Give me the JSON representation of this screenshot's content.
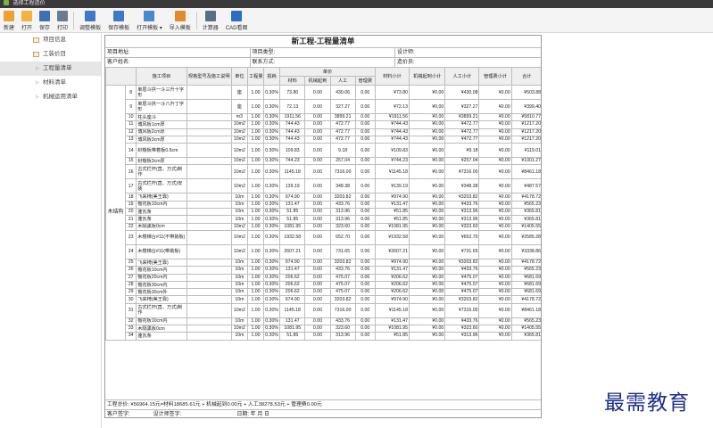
{
  "window": {
    "title": "选择工程造价"
  },
  "toolbar": {
    "items": [
      {
        "label": "新建",
        "icon": "new-file-icon",
        "color": "#f0a030"
      },
      {
        "label": "打开",
        "icon": "open-folder-icon",
        "color": "#f3b33d"
      },
      {
        "label": "保存",
        "icon": "save-icon",
        "color": "#3d6fb6"
      },
      {
        "label": "打印",
        "icon": "print-icon",
        "color": "#6b7b8c"
      },
      {
        "label": "调整模板",
        "icon": "template-adjust-icon",
        "color": "#3f78c8"
      },
      {
        "label": "保存模板",
        "icon": "template-save-icon",
        "color": "#3f78c8"
      },
      {
        "label": "打开模板 ▾",
        "icon": "template-open-icon",
        "color": "#4a88d0"
      },
      {
        "label": "导入模板",
        "icon": "template-import-icon",
        "color": "#e08a2c"
      },
      {
        "label": "计算器",
        "icon": "calculator-icon",
        "color": "#5a6e86"
      },
      {
        "label": "CAD看图",
        "icon": "cad-viewer-icon",
        "color": "#2c6cc4"
      }
    ]
  },
  "sidebar": {
    "items": [
      {
        "label": "项目信息",
        "type": "page"
      },
      {
        "label": "工装价目",
        "type": "page"
      },
      {
        "label": "工程量清单",
        "type": "node",
        "selected": true
      },
      {
        "label": "材料清单",
        "type": "node"
      },
      {
        "label": "机械运用清单",
        "type": "node"
      }
    ]
  },
  "document": {
    "title": "新工程-工程量清单",
    "info_row1": [
      "项目地址:",
      "项目类型:",
      "设计师:"
    ],
    "info_row2": [
      "客户姓名:",
      "联系方式:",
      "造价员:"
    ],
    "headers": {
      "unit_price_group": "单价",
      "cols": [
        "施工项目",
        "规格型号及施工说明",
        "单位",
        "工程量",
        "损耗",
        "材料",
        "机械起到",
        "人工",
        "管理费",
        "材料小计",
        "机械起到小计",
        "人工小计",
        "管理费小计",
        "合计"
      ]
    },
    "group_label": "木结构",
    "rows": [
      [
        "8",
        "单层斗拱一斗三升十字形",
        "座",
        "1.00",
        "0.30%",
        "73.80",
        "0.00",
        "430.06",
        "0.00",
        "¥73.80",
        "¥0.00",
        "¥430.08",
        "¥0.00",
        "¥503.88"
      ],
      [
        "9",
        "单层斗拱一斗八升丁字形",
        "座",
        "1.00",
        "0.30%",
        "72.13",
        "0.00",
        "327.27",
        "0.00",
        "¥72.13",
        "¥0.00",
        "¥327.27",
        "¥0.00",
        "¥399.40"
      ],
      [
        "10",
        "柱头座斗",
        "m3",
        "1.00",
        "0.30%",
        "1911.56",
        "0.00",
        "3899.21",
        "0.00",
        "¥1911.56",
        "¥0.00",
        "¥3899.21",
        "¥0.00",
        "¥5810.77"
      ],
      [
        "11",
        "博风板1cm厚",
        "10m2",
        "1.00",
        "0.30%",
        "744.43",
        "0.00",
        "472.77",
        "0.00",
        "¥744.43",
        "¥0.00",
        "¥472.77",
        "¥0.00",
        "¥1217.20"
      ],
      [
        "12",
        "博风板2cm厚",
        "10m2",
        "1.00",
        "0.30%",
        "744.43",
        "0.00",
        "472.77",
        "0.00",
        "¥744.43",
        "¥0.00",
        "¥472.77",
        "¥0.00",
        "¥1217.20"
      ],
      [
        "13",
        "博风板3cm厚",
        "10m2",
        "1.00",
        "0.30%",
        "744.43",
        "0.00",
        "472.77",
        "0.00",
        "¥744.43",
        "¥0.00",
        "¥472.77",
        "¥0.00",
        "¥1217.20"
      ],
      [
        "14",
        "封檐板带着板0.5cm",
        "10m2",
        "1.00",
        "0.30%",
        "109.83",
        "0.00",
        "9.18",
        "0.00",
        "¥109.83",
        "¥0.00",
        "¥9.18",
        "¥0.00",
        "¥119.01"
      ],
      [
        "15",
        "封檐板3cm厚",
        "10m2",
        "1.00",
        "0.30%",
        "744.23",
        "0.00",
        "257.04",
        "0.00",
        "¥744.23",
        "¥0.00",
        "¥257.04",
        "¥0.00",
        "¥1001.27"
      ],
      [
        "16",
        "古式栏杆(直、万式)制作",
        "10m2",
        "1.00",
        "0.30%",
        "1145.18",
        "0.00",
        "7316.00",
        "0.00",
        "¥1145.18",
        "¥0.00",
        "¥7316.00",
        "¥0.00",
        "¥8461.18"
      ],
      [
        "17",
        "古式栏杆(直、万式)安装",
        "10m2",
        "1.00",
        "0.30%",
        "139.19",
        "0.00",
        "348.38",
        "0.00",
        "¥139.19",
        "¥0.00",
        "¥348.38",
        "¥0.00",
        "¥487.57"
      ],
      [
        "18",
        "飞来椅(美王靠)",
        "10m",
        "1.00",
        "0.30%",
        "974.90",
        "0.00",
        "3203.82",
        "0.00",
        "¥974.90",
        "¥0.00",
        "¥3203.82",
        "¥0.00",
        "¥4178.72"
      ],
      [
        "19",
        "檐花板10cm内",
        "10m",
        "1.00",
        "0.30%",
        "131.47",
        "0.00",
        "433.76",
        "0.00",
        "¥131.47",
        "¥0.00",
        "¥433.76",
        "¥0.00",
        "¥565.23"
      ],
      [
        "20",
        "蓬瓦条",
        "10m",
        "1.00",
        "0.30%",
        "51.85",
        "0.00",
        "313.96",
        "0.00",
        "¥51.85",
        "¥0.00",
        "¥313.96",
        "¥0.00",
        "¥365.81"
      ],
      [
        "21",
        "蓬瓦条",
        "10m",
        "1.00",
        "0.30%",
        "51.85",
        "0.00",
        "313.96",
        "0.00",
        "¥51.85",
        "¥0.00",
        "¥313.96",
        "¥0.00",
        "¥365.81"
      ],
      [
        "22",
        "木隔黑板0cm",
        "10m2",
        "1.00",
        "0.30%",
        "1081.95",
        "0.00",
        "323.60",
        "0.00",
        "¥1081.95",
        "¥0.00",
        "¥323.60",
        "¥0.00",
        "¥1405.55"
      ],
      [
        "23",
        "木楼梯台#11(不带挑板)",
        "10m2",
        "1.00",
        "0.30%",
        "1932.58",
        "0.00",
        "652.70",
        "0.00",
        "¥1932.58",
        "¥0.00",
        "¥652.70",
        "¥0.00",
        "¥2585.28"
      ],
      [
        "24",
        "木楼梯台#11(带挑板)",
        "10m2",
        "1.00",
        "0.30%",
        "2607.21",
        "0.00",
        "731.65",
        "0.00",
        "¥2607.21",
        "¥0.00",
        "¥731.65",
        "¥0.00",
        "¥3338.86"
      ],
      [
        "25",
        "飞来椅(美王靠)",
        "10m",
        "1.00",
        "0.30%",
        "974.90",
        "0.00",
        "3203.82",
        "0.00",
        "¥974.90",
        "¥0.00",
        "¥3203.82",
        "¥0.00",
        "¥4178.72"
      ],
      [
        "26",
        "檐花板10cm内",
        "10m",
        "1.00",
        "0.30%",
        "131.47",
        "0.00",
        "433.76",
        "0.00",
        "¥131.47",
        "¥0.00",
        "¥433.76",
        "¥0.00",
        "¥565.23"
      ],
      [
        "27",
        "檐花板20cm内",
        "10m",
        "1.00",
        "0.30%",
        "206.62",
        "0.00",
        "475.07",
        "0.00",
        "¥206.62",
        "¥0.00",
        "¥475.07",
        "¥0.00",
        "¥681.69"
      ],
      [
        "28",
        "檐花板30cm内",
        "10m",
        "1.00",
        "0.30%",
        "206.62",
        "0.00",
        "475.07",
        "0.00",
        "¥206.62",
        "¥0.00",
        "¥475.07",
        "¥0.00",
        "¥681.69"
      ],
      [
        "29",
        "檐花板30cm外",
        "10m",
        "1.00",
        "0.30%",
        "206.62",
        "0.00",
        "475.07",
        "0.00",
        "¥206.62",
        "¥0.00",
        "¥475.07",
        "¥0.00",
        "¥681.69"
      ],
      [
        "30",
        "飞来椅(美王靠)",
        "10m",
        "1.00",
        "0.30%",
        "974.90",
        "0.00",
        "3203.82",
        "0.00",
        "¥974.90",
        "¥0.00",
        "¥3203.82",
        "¥0.00",
        "¥4178.72"
      ],
      [
        "31",
        "古式栏杆(直、万式)制作",
        "10m2",
        "1.00",
        "0.30%",
        "1145.18",
        "0.00",
        "7316.00",
        "0.00",
        "¥1145.18",
        "¥0.00",
        "¥7316.00",
        "¥0.00",
        "¥8461.18"
      ],
      [
        "32",
        "檐花板10cm内",
        "10m",
        "1.00",
        "0.30%",
        "131.47",
        "0.00",
        "433.76",
        "0.00",
        "¥131.47",
        "¥0.00",
        "¥433.76",
        "¥0.00",
        "¥565.23"
      ],
      [
        "33",
        "木隔黑板0cm",
        "10m2",
        "1.00",
        "0.30%",
        "1081.95",
        "0.00",
        "323.60",
        "0.00",
        "¥1081.95",
        "¥0.00",
        "¥323.60",
        "¥0.00",
        "¥1405.55"
      ],
      [
        "34",
        "蓬瓦条",
        "10m",
        "1.00",
        "0.30%",
        "51.85",
        "0.00",
        "313.96",
        "0.00",
        "¥51.85",
        "¥0.00",
        "¥313.96",
        "¥0.00",
        "¥365.81"
      ]
    ],
    "summary": "工程总价: ¥56964.15元=材料18685.61元 + 机械起到0.00元 + 人工38278.53元 + 管理费0.00元",
    "sign_row": [
      "客户签字:",
      "设计师签字:",
      "日期:    年    月    日"
    ]
  },
  "watermark": "最需教育"
}
